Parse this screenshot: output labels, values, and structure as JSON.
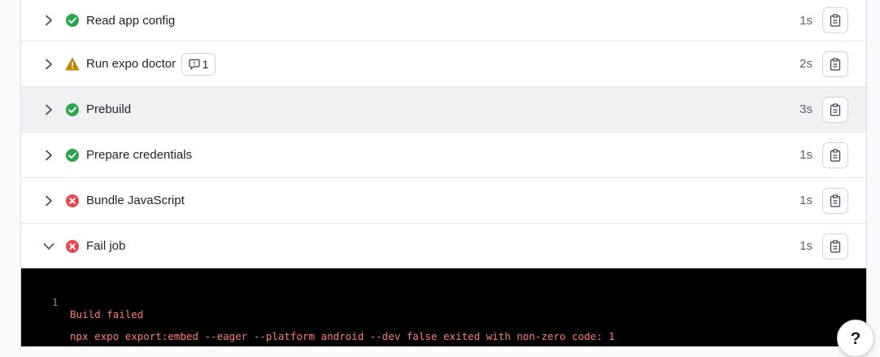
{
  "steps": [
    {
      "title": "Read app config",
      "status": "success",
      "duration": "1s",
      "expanded": false
    },
    {
      "title": "Run expo doctor",
      "status": "warning",
      "duration": "2s",
      "expanded": false,
      "badge_count": "1"
    },
    {
      "title": "Prebuild",
      "status": "success",
      "duration": "3s",
      "expanded": false
    },
    {
      "title": "Prepare credentials",
      "status": "success",
      "duration": "1s",
      "expanded": false
    },
    {
      "title": "Bundle JavaScript",
      "status": "error",
      "duration": "1s",
      "expanded": false
    },
    {
      "title": "Fail job",
      "status": "error",
      "duration": "1s",
      "expanded": true
    }
  ],
  "log": {
    "line_number": "1",
    "line1": "Build failed",
    "line2": "npx expo export:embed --eager --platform android --dev false exited with non-zero code: 1"
  },
  "help_label": "?",
  "colors": {
    "success": "#2da44e",
    "warning": "#bf8700",
    "error": "#e5484d",
    "log_text": "#ff7b72"
  }
}
